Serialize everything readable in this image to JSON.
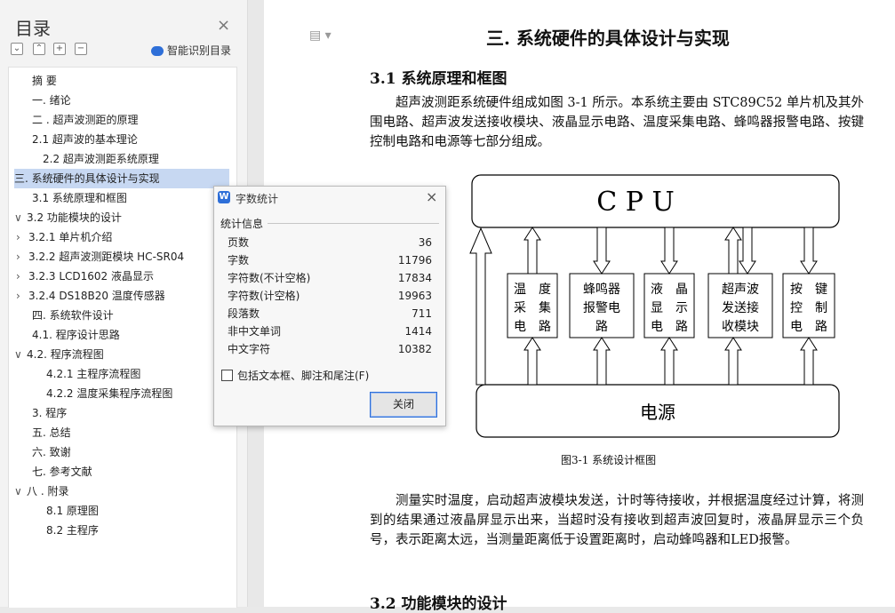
{
  "sidebar": {
    "title": "目录",
    "close_icon": "close-icon",
    "smart_label": "智能识别目录",
    "items": [
      {
        "label": "摘  要",
        "chev": ""
      },
      {
        "label": "一. 绪论",
        "chev": ""
      },
      {
        "label": "二 . 超声波测距的原理",
        "chev": ""
      },
      {
        "label": "2.1  超声波的基本理论",
        "chev": ""
      },
      {
        "label": "2.2  超声波测距系统原理",
        "chev": ""
      },
      {
        "label": "三. 系统硬件的具体设计与实现",
        "chev": ""
      },
      {
        "label": "3.1  系统原理和框图",
        "chev": ""
      },
      {
        "label": "3.2  功能模块的设计",
        "chev": "∨"
      },
      {
        "label": "3.2.1  单片机介绍",
        "chev": "›"
      },
      {
        "label": "3.2.2    超声波测距模块 HC-SR04",
        "chev": "›"
      },
      {
        "label": "3.2.3    LCD1602 液晶显示",
        "chev": "›"
      },
      {
        "label": "3.2.4 DS18B20 温度传感器",
        "chev": "›"
      },
      {
        "label": "四. 系统软件设计",
        "chev": ""
      },
      {
        "label": "4.1. 程序设计思路",
        "chev": ""
      },
      {
        "label": "4.2.  程序流程图",
        "chev": "∨"
      },
      {
        "label": "4.2.1 主程序流程图",
        "chev": ""
      },
      {
        "label": "4.2.2  温度采集程序流程图",
        "chev": ""
      },
      {
        "label": "3.  程序",
        "chev": ""
      },
      {
        "label": "五. 总结",
        "chev": ""
      },
      {
        "label": "六. 致谢",
        "chev": ""
      },
      {
        "label": "七. 参考文献",
        "chev": ""
      },
      {
        "label": "八 . 附录",
        "chev": "∨"
      },
      {
        "label": "8.1 原理图",
        "chev": ""
      },
      {
        "label": "8.2 主程序",
        "chev": ""
      }
    ]
  },
  "document": {
    "heading": "三. 系统硬件的具体设计与实现",
    "section": "3.1  系统原理和框图",
    "para1": "超声波测距系统硬件组成如图 3-1 所示。本系统主要由 STC89C52 单片机及其外围电路、超声波发送接收模块、液晶显示电路、温度采集电路、蜂鸣器报警电路、按键控制电路和电源等七部分组成。",
    "caption": "图3-1  系统设计框图",
    "para2": "测量实时温度，启动超声波模块发送，计时等待接收，并根据温度经过计算，将测到的结果通过液晶屏显示出来，当超时没有接收到超声波回复时，液晶屏显示三个负号，表示距离太远，当测量距离低于设置距离时，启动蜂鸣器和LED报警。",
    "section2": "3.2  功能模块的设计",
    "diagram": {
      "cpu": "C P U",
      "power": "电源",
      "modules": [
        [
          "温　度",
          "采　集",
          "电　路"
        ],
        [
          "蜂鸣器",
          "报警电",
          "路"
        ],
        [
          "液　晶",
          "显　示",
          "电　路"
        ],
        [
          "超声波",
          "发送接",
          "收模块"
        ],
        [
          "按　键",
          "控　制",
          "电　路"
        ]
      ]
    }
  },
  "dialog": {
    "title": "字数统计",
    "section": "统计信息",
    "stats": [
      {
        "label": "页数",
        "value": "36"
      },
      {
        "label": "字数",
        "value": "11796"
      },
      {
        "label": "字符数(不计空格)",
        "value": "17834"
      },
      {
        "label": "字符数(计空格)",
        "value": "19963"
      },
      {
        "label": "段落数",
        "value": "711"
      },
      {
        "label": "非中文单词",
        "value": "1414"
      },
      {
        "label": "中文字符",
        "value": "10382"
      }
    ],
    "checkbox_label": "包括文本框、脚注和尾注(F)",
    "close_button": "关闭"
  }
}
